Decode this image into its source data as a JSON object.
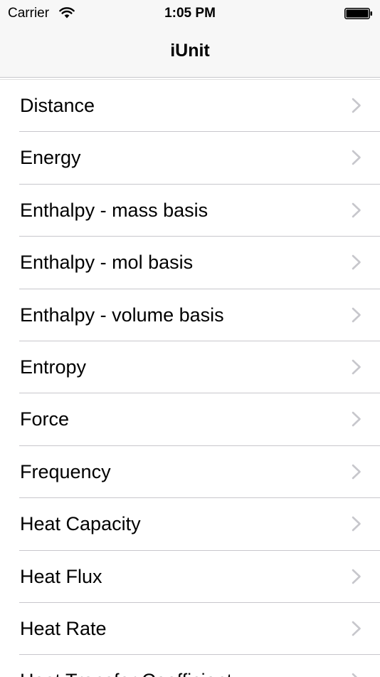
{
  "status_bar": {
    "carrier": "Carrier",
    "time": "1:05 PM",
    "wifi_icon": "wifi-icon",
    "battery_icon": "battery-icon"
  },
  "nav": {
    "title": "iUnit"
  },
  "list": {
    "chevron_icon": "chevron-right-icon",
    "chevron_color": "#c7c7cc",
    "separator_color": "#c8c7cc",
    "items": [
      {
        "label": "Distance"
      },
      {
        "label": "Energy"
      },
      {
        "label": "Enthalpy - mass basis"
      },
      {
        "label": "Enthalpy - mol basis"
      },
      {
        "label": "Enthalpy - volume basis"
      },
      {
        "label": "Entropy"
      },
      {
        "label": "Force"
      },
      {
        "label": "Frequency"
      },
      {
        "label": "Heat Capacity"
      },
      {
        "label": "Heat Flux"
      },
      {
        "label": "Heat Rate"
      },
      {
        "label": "Heat Transfer Coefficient"
      }
    ]
  }
}
